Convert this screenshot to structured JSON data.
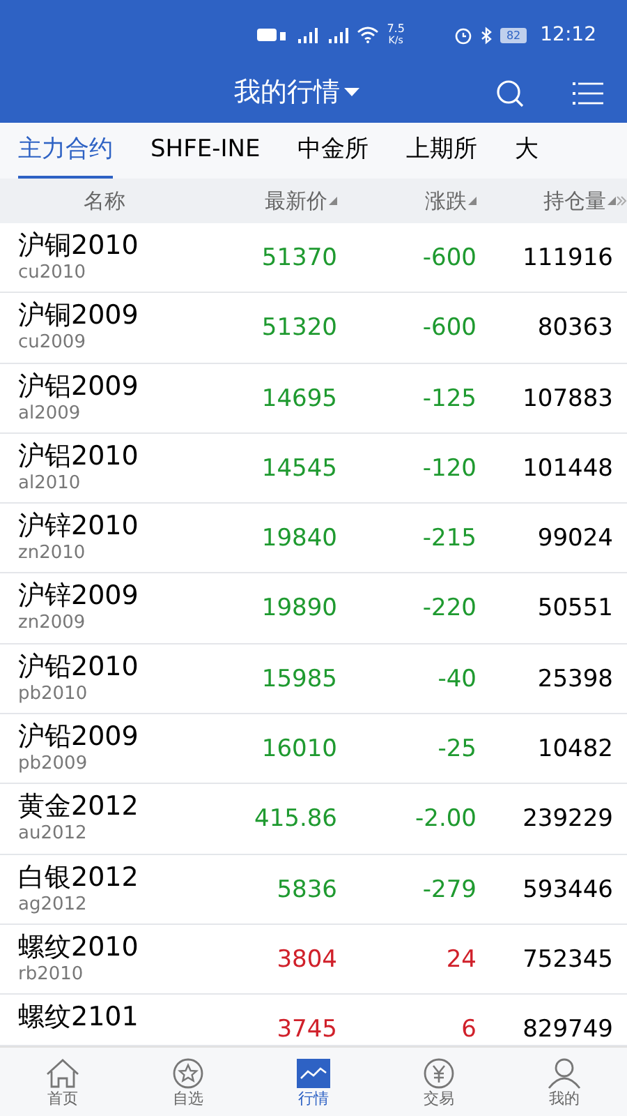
{
  "status_bar": {
    "speed": "7.5",
    "speed_unit": "K/s",
    "battery": "82",
    "time": "12:12"
  },
  "header": {
    "title": "我的行情"
  },
  "tabs": [
    {
      "label": "主力合约",
      "selected": true
    },
    {
      "label": "SHFE-INE",
      "selected": false
    },
    {
      "label": "中金所",
      "selected": false
    },
    {
      "label": "上期所",
      "selected": false
    },
    {
      "label": "大",
      "selected": false
    }
  ],
  "table": {
    "columns": [
      "名称",
      "最新价",
      "涨跌",
      "持仓量"
    ],
    "rows": [
      {
        "name": "沪铜2010",
        "code": "cu2010",
        "price": "51370",
        "change": "-600",
        "open_interest": "111916",
        "rising": false
      },
      {
        "name": "沪铜2009",
        "code": "cu2009",
        "price": "51320",
        "change": "-600",
        "open_interest": "80363",
        "rising": false
      },
      {
        "name": "沪铝2009",
        "code": "al2009",
        "price": "14695",
        "change": "-125",
        "open_interest": "107883",
        "rising": false
      },
      {
        "name": "沪铝2010",
        "code": "al2010",
        "price": "14545",
        "change": "-120",
        "open_interest": "101448",
        "rising": false
      },
      {
        "name": "沪锌2010",
        "code": "zn2010",
        "price": "19840",
        "change": "-215",
        "open_interest": "99024",
        "rising": false
      },
      {
        "name": "沪锌2009",
        "code": "zn2009",
        "price": "19890",
        "change": "-220",
        "open_interest": "50551",
        "rising": false
      },
      {
        "name": "沪铅2010",
        "code": "pb2010",
        "price": "15985",
        "change": "-40",
        "open_interest": "25398",
        "rising": false
      },
      {
        "name": "沪铅2009",
        "code": "pb2009",
        "price": "16010",
        "change": "-25",
        "open_interest": "10482",
        "rising": false
      },
      {
        "name": "黄金2012",
        "code": "au2012",
        "price": "415.86",
        "change": "-2.00",
        "open_interest": "239229",
        "rising": false
      },
      {
        "name": "白银2012",
        "code": "ag2012",
        "price": "5836",
        "change": "-279",
        "open_interest": "593446",
        "rising": false
      },
      {
        "name": "螺纹2010",
        "code": "rb2010",
        "price": "3804",
        "change": "24",
        "open_interest": "752345",
        "rising": true
      },
      {
        "name": "螺纹2101",
        "price": "3745",
        "change": "6",
        "open_interest": "829749",
        "rising": true
      }
    ]
  },
  "bottom_nav": [
    {
      "label": "首页",
      "kind": "home",
      "selected": false
    },
    {
      "label": "自选",
      "kind": "star",
      "selected": false
    },
    {
      "label": "行情",
      "kind": "chart",
      "selected": true
    },
    {
      "label": "交易",
      "kind": "yen",
      "selected": false
    },
    {
      "label": "我的",
      "kind": "user",
      "selected": false
    }
  ]
}
